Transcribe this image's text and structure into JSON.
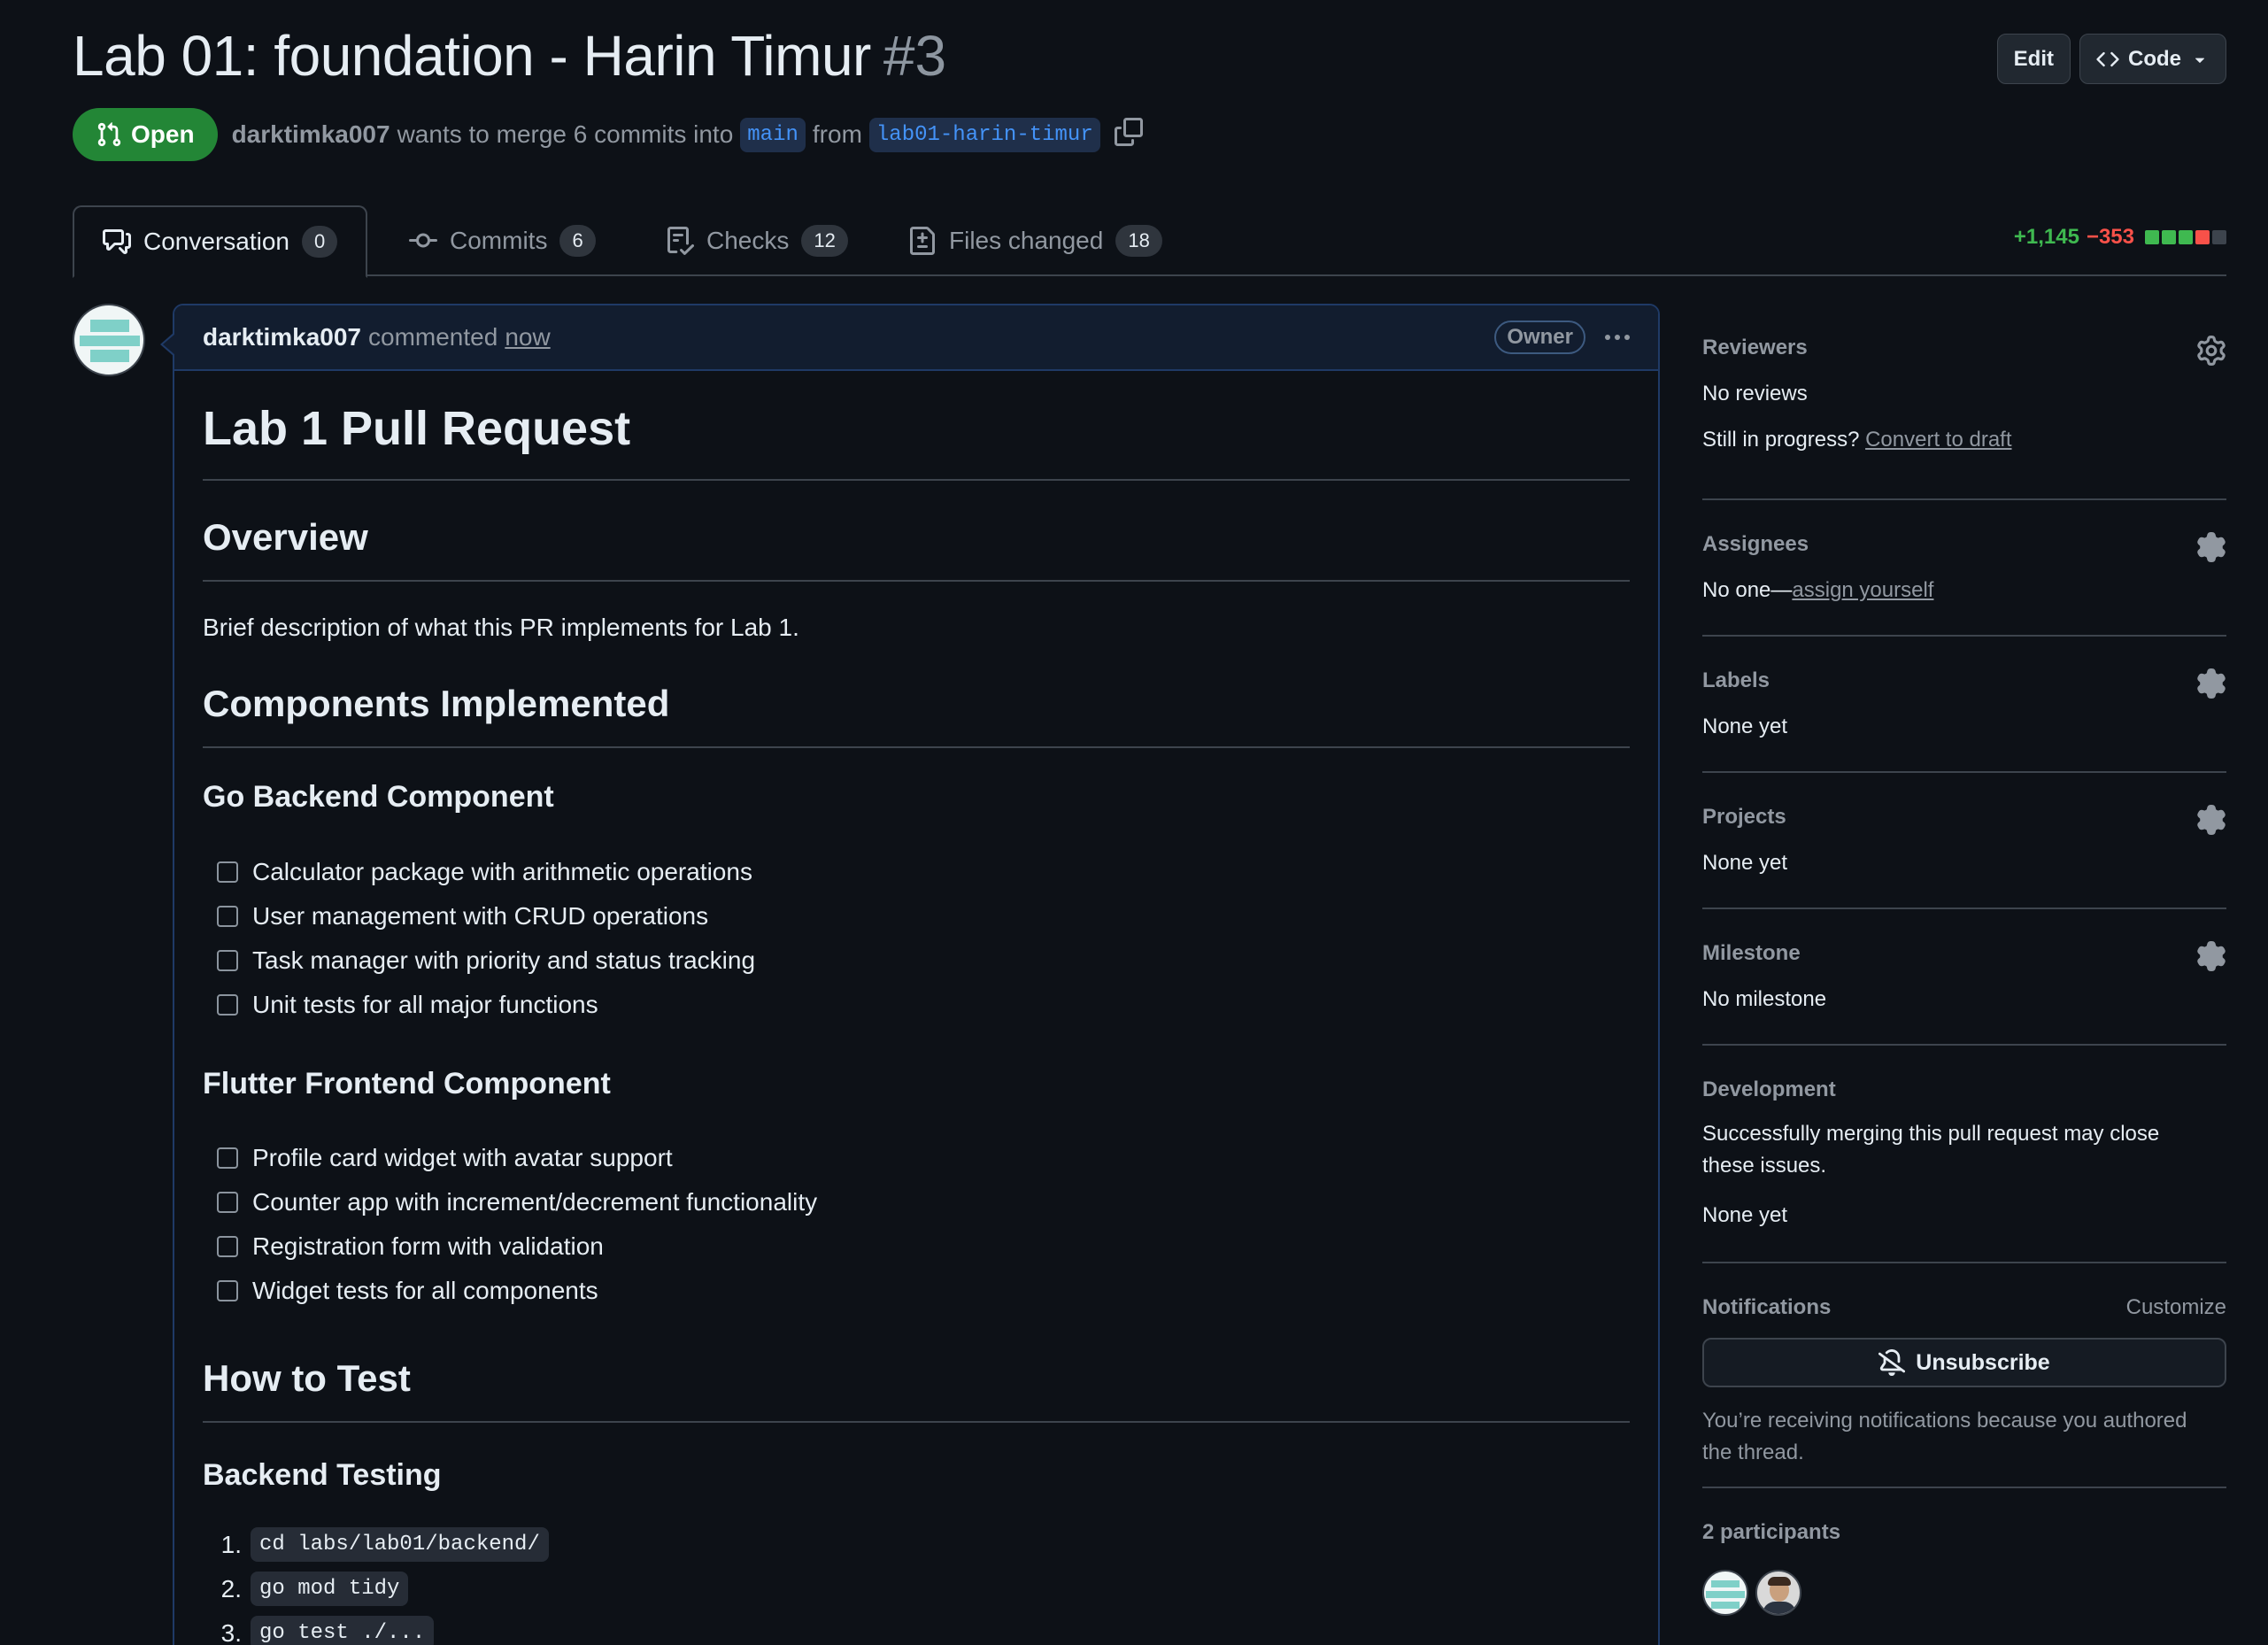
{
  "pr": {
    "title": "Lab 01: foundation - Harin Timur",
    "number": "#3",
    "state": "Open",
    "author": "darktimka007",
    "merge_text": "wants to merge 6 commits into",
    "base_branch": "main",
    "from_text": "from",
    "head_branch": "lab01-harin-timur"
  },
  "header_actions": {
    "edit_label": "Edit",
    "code_label": "Code"
  },
  "tabs": [
    {
      "label": "Conversation",
      "count": "0",
      "icon": "comment-discussion-icon",
      "active": true
    },
    {
      "label": "Commits",
      "count": "6",
      "icon": "git-commit-icon",
      "active": false
    },
    {
      "label": "Checks",
      "count": "12",
      "icon": "checklist-icon",
      "active": false
    },
    {
      "label": "Files changed",
      "count": "18",
      "icon": "file-diff-icon",
      "active": false
    }
  ],
  "diffstat": {
    "additions": "+1,145",
    "deletions": "−353",
    "blocks": [
      "#3fb950",
      "#3fb950",
      "#3fb950",
      "#f85149",
      "#3d444d"
    ]
  },
  "comment": {
    "author": "darktimka007",
    "verb": "commented",
    "time": "now",
    "badge": "Owner",
    "body": {
      "h1": "Lab 1 Pull Request",
      "overview_heading": "Overview",
      "overview_text": "Brief description of what this PR implements for Lab 1.",
      "components_heading": "Components Implemented",
      "go_heading": "Go Backend Component",
      "go_tasks": [
        "Calculator package with arithmetic operations",
        "User management with CRUD operations",
        "Task manager with priority and status tracking",
        "Unit tests for all major functions"
      ],
      "flutter_heading": "Flutter Frontend Component",
      "flutter_tasks": [
        "Profile card widget with avatar support",
        "Counter app with increment/decrement functionality",
        "Registration form with validation",
        "Widget tests for all components"
      ],
      "howto_heading": "How to Test",
      "backend_heading": "Backend Testing",
      "backend_steps": [
        "cd labs/lab01/backend/",
        "go mod tidy",
        "go test ./..."
      ]
    }
  },
  "sidebar": {
    "reviewers": {
      "title": "Reviewers",
      "value": "No reviews",
      "draft_prompt": "Still in progress?",
      "draft_link": "Convert to draft"
    },
    "assignees": {
      "title": "Assignees",
      "value": "No one—",
      "link": "assign yourself"
    },
    "labels": {
      "title": "Labels",
      "value": "None yet"
    },
    "projects": {
      "title": "Projects",
      "value": "None yet"
    },
    "milestone": {
      "title": "Milestone",
      "value": "No milestone"
    },
    "development": {
      "title": "Development",
      "text_line1": "Successfully merging this pull request may close",
      "text_line2": "these issues.",
      "value": "None yet"
    },
    "notifications": {
      "title": "Notifications",
      "customize": "Customize",
      "button": "Unsubscribe",
      "note_line1": "You’re receiving notifications because you authored",
      "note_line2": "the thread."
    },
    "participants": {
      "title": "2 participants"
    }
  }
}
